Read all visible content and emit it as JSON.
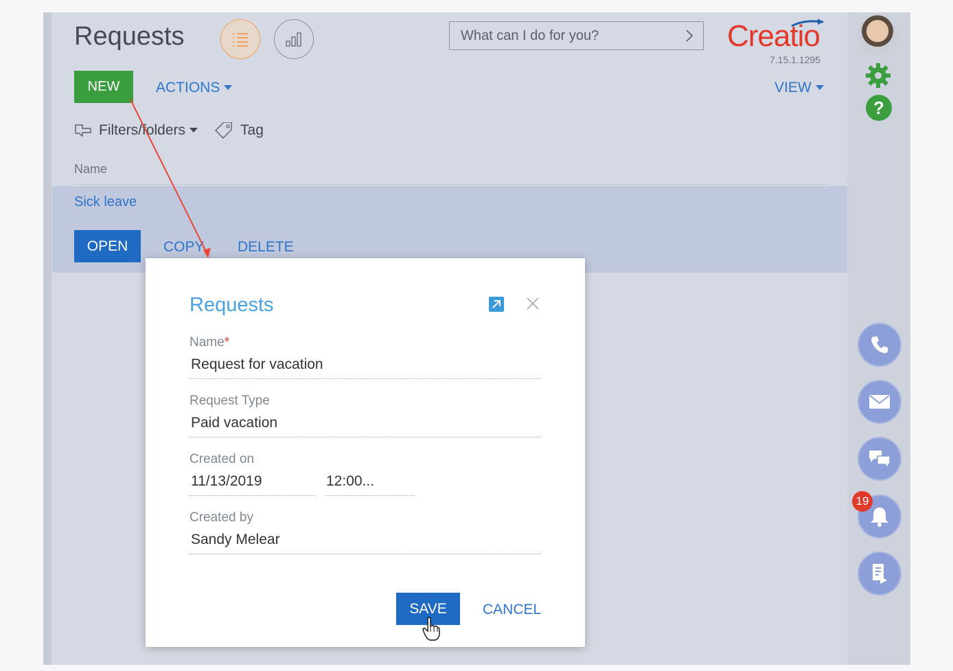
{
  "header": {
    "title": "Requests",
    "search_placeholder": "What can I do for you?",
    "logo_text": "Creatio",
    "version": "7.15.1.1295"
  },
  "toolbar": {
    "new_label": "NEW",
    "actions_label": "ACTIONS",
    "view_label": "VIEW"
  },
  "filters": {
    "filters_label": "Filters/folders",
    "tag_label": "Tag"
  },
  "list": {
    "column_name": "Name",
    "rows": [
      {
        "name": "Sick leave"
      }
    ],
    "row_actions": {
      "open_label": "OPEN",
      "copy_label": "COPY",
      "delete_label": "DELETE"
    }
  },
  "sidebar": {
    "notification_count": "19",
    "help_label": "?"
  },
  "modal": {
    "title": "Requests",
    "fields": {
      "name_label": "Name",
      "name_required_mark": "*",
      "name_value": "Request for vacation",
      "type_label": "Request Type",
      "type_value": "Paid vacation",
      "created_on_label": "Created on",
      "created_on_date": "11/13/2019",
      "created_on_time": "12:00...",
      "created_by_label": "Created by",
      "created_by_value": "Sandy Melear"
    },
    "save_label": "SAVE",
    "cancel_label": "CANCEL"
  },
  "colors": {
    "accent_blue": "#1f6bc4",
    "link_blue": "#2e74c9",
    "new_green": "#3a9e3f",
    "logo_red": "#e2392c",
    "annotation_arrow": "#e8473a"
  }
}
